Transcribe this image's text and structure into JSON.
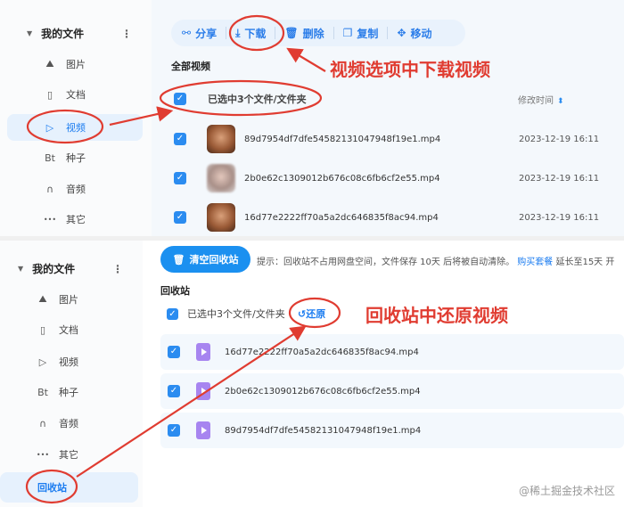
{
  "top": {
    "sidebar": {
      "header": "我的文件",
      "items": [
        {
          "icon": "image-icon",
          "glyph": "⛰",
          "label": "图片"
        },
        {
          "icon": "document-icon",
          "glyph": "▯",
          "label": "文档"
        },
        {
          "icon": "play-icon",
          "glyph": "▷",
          "label": "视频",
          "active": true
        },
        {
          "icon": "torrent-icon",
          "glyph": "Bt",
          "label": "种子"
        },
        {
          "icon": "headphones-icon",
          "glyph": "∩",
          "label": "音频"
        },
        {
          "icon": "more-dots-icon",
          "glyph": "•••",
          "label": "其它"
        }
      ]
    },
    "toolbar": {
      "share": "分享",
      "download": "下载",
      "delete": "删除",
      "copy": "复制",
      "move": "移动"
    },
    "section_title": "全部视频",
    "selection_text": "已选中3个文件/文件夹",
    "column_modified": "修改时间",
    "files": [
      {
        "name": "89d7954df7dfe54582131047948f19e1.mp4",
        "date": "2023-12-19 16:11"
      },
      {
        "name": "2b0e62c1309012b676c08c6fb6cf2e55.mp4",
        "date": "2023-12-19 16:11"
      },
      {
        "name": "16d77e2222ff70a5a2dc646835f8ac94.mp4",
        "date": "2023-12-19 16:11"
      }
    ]
  },
  "bottom": {
    "sidebar": {
      "header": "我的文件",
      "items": [
        {
          "icon": "image-icon",
          "glyph": "⛰",
          "label": "图片"
        },
        {
          "icon": "document-icon",
          "glyph": "▯",
          "label": "文档"
        },
        {
          "icon": "play-icon",
          "glyph": "▷",
          "label": "视频"
        },
        {
          "icon": "torrent-icon",
          "glyph": "Bt",
          "label": "种子"
        },
        {
          "icon": "headphones-icon",
          "glyph": "∩",
          "label": "音频"
        },
        {
          "icon": "more-dots-icon",
          "glyph": "•••",
          "label": "其它"
        }
      ],
      "recycle_label": "回收站"
    },
    "clear_button": "清空回收站",
    "hint": "提示：回收站不占用网盘空间，文件保存 10天 后将被自动清除。",
    "hint_link": "购买套餐",
    "hint_tail": " 延长至15天 开",
    "section_title": "回收站",
    "selection_text": "已选中3个文件/文件夹",
    "restore": "还原",
    "files": [
      {
        "name": "16d77e2222ff70a5a2dc646835f8ac94.mp4"
      },
      {
        "name": "2b0e62c1309012b676c08c6fb6cf2e55.mp4"
      },
      {
        "name": "89d7954df7dfe54582131047948f19e1.mp4"
      }
    ]
  },
  "annotations": {
    "download_note": "视频选项中下载视频",
    "restore_note": "回收站中还原视频",
    "color": "#e03c31"
  },
  "watermark": "@稀土掘金技术社区"
}
